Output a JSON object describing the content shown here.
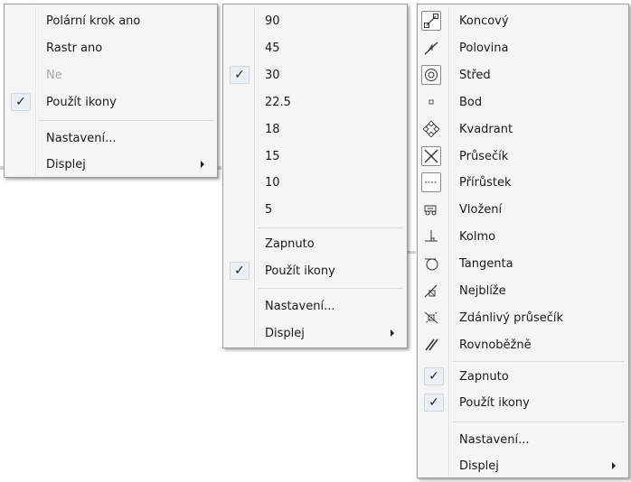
{
  "menu1": {
    "items": [
      {
        "label": "Polární krok ano",
        "checked": false,
        "disabled": false
      },
      {
        "label": "Rastr ano",
        "checked": false,
        "disabled": false
      },
      {
        "label": "Ne",
        "checked": false,
        "disabled": true
      },
      {
        "label": "Použít ikony",
        "checked": true,
        "disabled": false
      }
    ],
    "settings": "Nastavení...",
    "display": "Displej"
  },
  "menu2": {
    "angles": [
      "90",
      "45",
      "30",
      "22.5",
      "18",
      "15",
      "10",
      "5"
    ],
    "selected_angle": "30",
    "on": "Zapnuto",
    "use_icons": "Použít ikony",
    "settings": "Nastavení...",
    "display": "Displej"
  },
  "menu3": {
    "snaps": [
      {
        "label": "Koncový",
        "icon": "endpoint-icon"
      },
      {
        "label": "Polovina",
        "icon": "midpoint-icon"
      },
      {
        "label": "Střed",
        "icon": "center-icon"
      },
      {
        "label": "Bod",
        "icon": "node-icon"
      },
      {
        "label": "Kvadrant",
        "icon": "quadrant-icon"
      },
      {
        "label": "Průsečík",
        "icon": "intersection-icon"
      },
      {
        "label": "Přírůstek",
        "icon": "extension-icon"
      },
      {
        "label": "Vložení",
        "icon": "insertion-icon"
      },
      {
        "label": "Kolmo",
        "icon": "perpendicular-icon"
      },
      {
        "label": "Tangenta",
        "icon": "tangent-icon"
      },
      {
        "label": "Nejblíže",
        "icon": "nearest-icon"
      },
      {
        "label": "Zdánlivý průsečík",
        "icon": "apparent-intersection-icon"
      },
      {
        "label": "Rovnoběžně",
        "icon": "parallel-icon"
      }
    ],
    "on": "Zapnuto",
    "use_icons": "Použít ikony",
    "settings": "Nastavení...",
    "display": "Displej"
  },
  "check_glyph": "✓"
}
